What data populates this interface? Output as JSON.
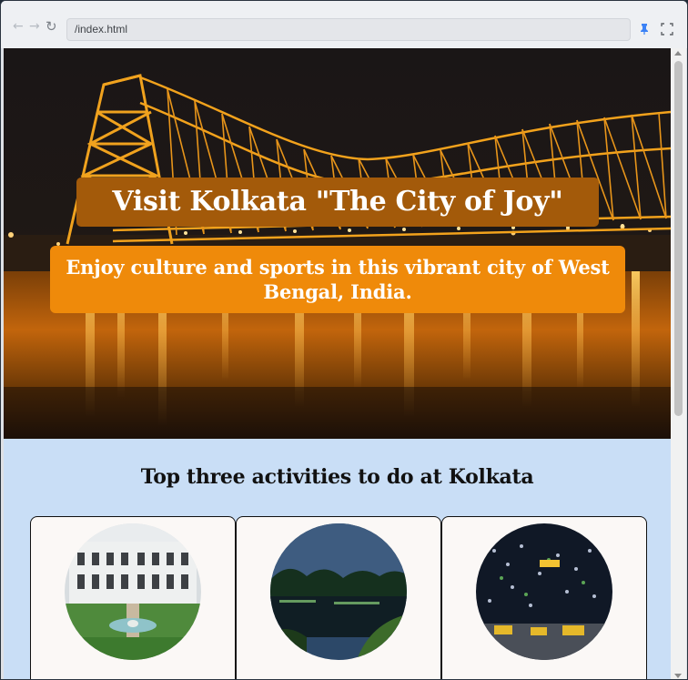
{
  "browser": {
    "url": "/index.html",
    "back_icon": "arrow-left-icon",
    "forward_icon": "arrow-right-icon",
    "reload_icon": "reload-icon",
    "pin_icon": "pin-icon",
    "fullscreen_icon": "fullscreen-icon",
    "pin_color": "#3b82f6"
  },
  "hero": {
    "title": "Visit Kolkata \"The City of Joy\"",
    "subtitle": "Enjoy culture and sports in this vibrant city of West Bengal, India.",
    "title_bg": "#a35a0a",
    "subtitle_bg": "#ef8a0a"
  },
  "activities": {
    "heading": "Top three activities to do at Kolkata",
    "section_bg": "#c9def6",
    "cards": [
      {
        "image": "colonial-building-photo"
      },
      {
        "image": "lake-night-photo"
      },
      {
        "image": "festive-lights-street-photo"
      }
    ]
  }
}
